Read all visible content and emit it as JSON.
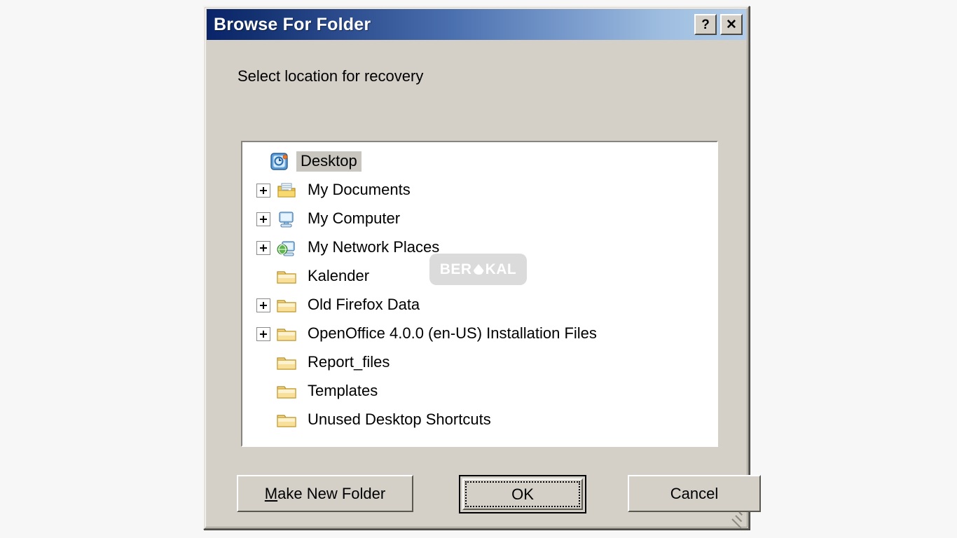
{
  "window": {
    "title": "Browse For Folder",
    "help_button": "?",
    "close_button": "✕",
    "help_icon_name": "help-icon",
    "close_icon_name": "close-icon"
  },
  "prompt": "Select location for recovery",
  "tree": {
    "items": [
      {
        "label": "Desktop",
        "icon": "desktop-icon",
        "expandable": false,
        "indent": 0,
        "selected": true
      },
      {
        "label": "My Documents",
        "icon": "my-documents-icon",
        "expandable": true,
        "indent": 1,
        "selected": false
      },
      {
        "label": "My Computer",
        "icon": "my-computer-icon",
        "expandable": true,
        "indent": 1,
        "selected": false
      },
      {
        "label": "My Network Places",
        "icon": "my-network-places-icon",
        "expandable": true,
        "indent": 1,
        "selected": false
      },
      {
        "label": "Kalender",
        "icon": "folder-icon",
        "expandable": false,
        "indent": 1,
        "selected": false
      },
      {
        "label": "Old Firefox Data",
        "icon": "folder-icon",
        "expandable": true,
        "indent": 1,
        "selected": false
      },
      {
        "label": "OpenOffice 4.0.0 (en-US) Installation Files",
        "icon": "folder-icon",
        "expandable": true,
        "indent": 1,
        "selected": false
      },
      {
        "label": "Report_files",
        "icon": "folder-icon",
        "expandable": false,
        "indent": 1,
        "selected": false
      },
      {
        "label": "Templates",
        "icon": "folder-icon",
        "expandable": false,
        "indent": 1,
        "selected": false
      },
      {
        "label": "Unused Desktop Shortcuts",
        "icon": "folder-icon",
        "expandable": false,
        "indent": 1,
        "selected": false
      }
    ]
  },
  "buttons": {
    "make_new_folder_accel": "M",
    "make_new_folder_rest": "ake New Folder",
    "ok": "OK",
    "cancel": "Cancel"
  },
  "watermark": {
    "text_left": "BER",
    "text_right": "KAL"
  },
  "colors": {
    "dialog_face": "#d4d0c8",
    "title_gradient_start": "#0a246a",
    "title_gradient_end": "#b2cde9",
    "tree_background": "#ffffff",
    "selection": "#c8c6bf",
    "page_background": "#f7f7f7"
  }
}
